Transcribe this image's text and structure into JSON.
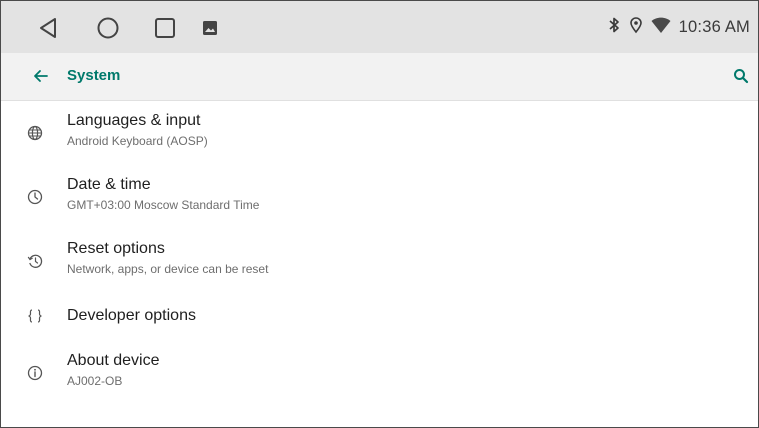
{
  "status_bar": {
    "time": "10:36 AM",
    "icons": [
      "back-icon",
      "home-icon",
      "recents-icon",
      "gallery-icon",
      "bluetooth-icon",
      "location-icon",
      "wifi-icon"
    ]
  },
  "app_bar": {
    "title": "System",
    "back_icon": "arrow-left-icon",
    "search_icon": "search-icon",
    "accent": "#00796b"
  },
  "settings": [
    {
      "icon": "globe-icon",
      "title": "Languages & input",
      "subtitle": "Android Keyboard (AOSP)"
    },
    {
      "icon": "clock-icon",
      "title": "Date & time",
      "subtitle": "GMT+03:00 Moscow Standard Time"
    },
    {
      "icon": "history-icon",
      "title": "Reset options",
      "subtitle": "Network, apps, or device can be reset"
    },
    {
      "icon": "braces-icon",
      "title": "Developer options",
      "subtitle": ""
    },
    {
      "icon": "info-icon",
      "title": "About device",
      "subtitle": "AJ002-OB"
    }
  ]
}
